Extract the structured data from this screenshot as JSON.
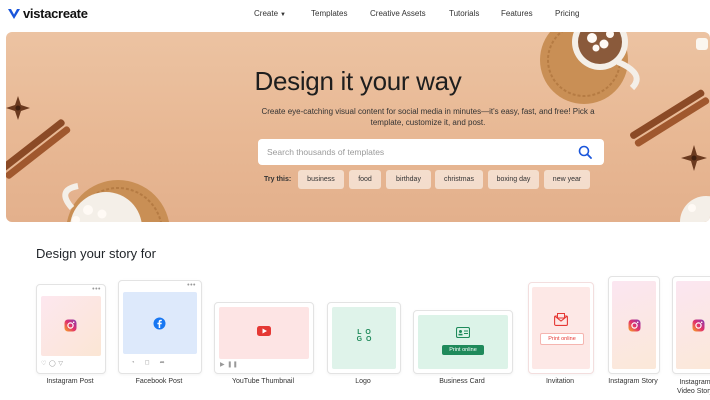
{
  "header": {
    "brand": "vistacreate",
    "nav": [
      {
        "label": "Create"
      },
      {
        "label": "Templates"
      },
      {
        "label": "Creative Assets"
      },
      {
        "label": "Tutorials"
      },
      {
        "label": "Features"
      },
      {
        "label": "Pricing"
      }
    ]
  },
  "hero": {
    "title": "Design it your way",
    "subtitle": "Create eye-catching visual content for social media in minutes—it's easy, fast, and free! Pick a template, customize it, and post.",
    "search_placeholder": "Search thousands of templates",
    "try_label": "Try this:",
    "tags": [
      "business",
      "food",
      "birthday",
      "christmas",
      "boxing day",
      "new year"
    ]
  },
  "story": {
    "title": "Design your story for",
    "cards": [
      {
        "label": "Instagram Post",
        "icon": "instagram-icon"
      },
      {
        "label": "Facebook Post",
        "icon": "facebook-icon"
      },
      {
        "label": "YouTube Thumbnail",
        "icon": "youtube-icon"
      },
      {
        "label": "Logo",
        "icon": "logo-icon",
        "text": "L O G O"
      },
      {
        "label": "Business Card",
        "icon": "id-card-icon",
        "button": "Print online"
      },
      {
        "label": "Invitation",
        "icon": "envelope-icon",
        "button": "Print online"
      },
      {
        "label": "Instagram Story",
        "icon": "instagram-icon"
      },
      {
        "label": "Instagram Video Story",
        "icon": "instagram-icon"
      }
    ]
  },
  "colors": {
    "brand": "#1a56db",
    "hero_bg": "#e8b894",
    "accent_green": "#1f8a5b",
    "accent_red": "#e53935"
  }
}
